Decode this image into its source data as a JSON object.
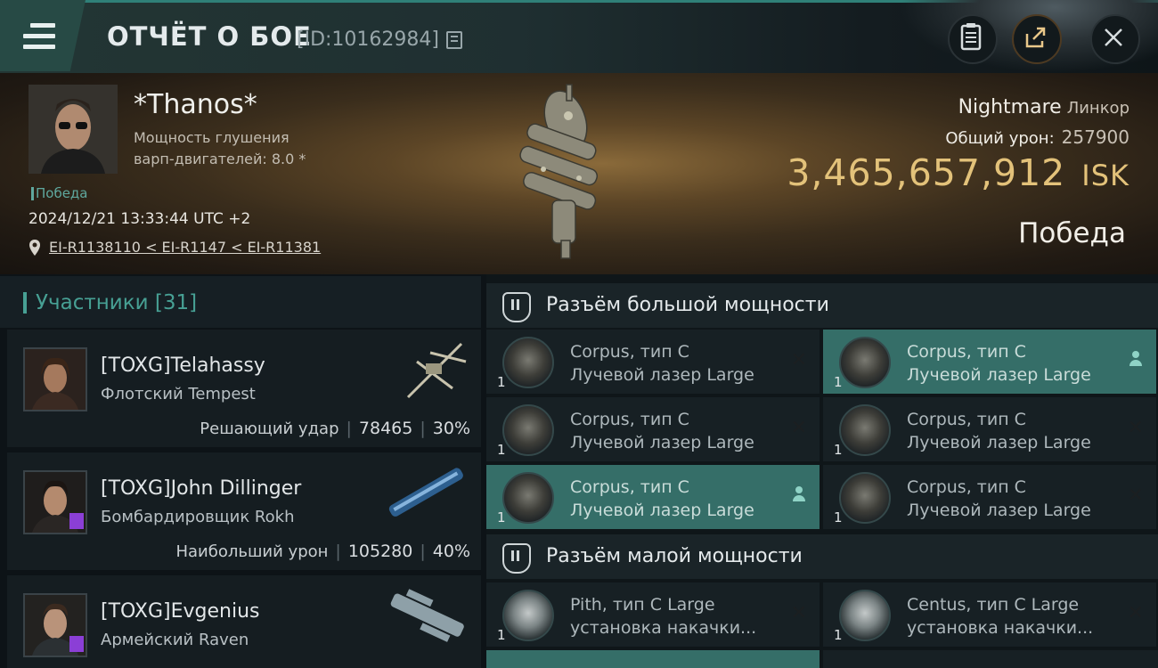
{
  "header": {
    "title": "ОТЧЁТ О БОЕ",
    "report_id": "[ID:10162984]",
    "icons": [
      "menu-icon",
      "copy-icon",
      "clipboard-icon",
      "share-icon",
      "close-icon"
    ]
  },
  "victim": {
    "name": "*Thanos*",
    "stat_line1": "Мощность глушения",
    "stat_line2": "варп-двигателей: 8.0 *",
    "result_small": "Победа",
    "datetime": "2024/12/21 13:33:44 UTC +2",
    "route": "EI-R1138110 < EI-R1147 < EI-R11381",
    "ship_name": "Nightmare",
    "ship_class": "Линкор",
    "damage_label": "Общий урон:",
    "damage_value": "257900",
    "isk_value": "3,465,657,912",
    "isk_unit": "ISK",
    "result_big": "Победа"
  },
  "participants": {
    "header": "Участники [31]",
    "items": [
      {
        "name": "[TOXG]Telahassy",
        "ship": "Флотский Tempest",
        "label": "Решающий удар",
        "damage": "78465",
        "percent": "30%"
      },
      {
        "name": "[TOXG]John Dillinger",
        "ship": "Бомбардировщик Rokh",
        "label": "Наибольший урон",
        "damage": "105280",
        "percent": "40%"
      },
      {
        "name": "[TOXG]Evgenius",
        "ship": "Армейский Raven",
        "label": "",
        "damage": "",
        "percent": ""
      }
    ]
  },
  "slots": {
    "high": {
      "title": "Разъём большой мощности",
      "modules": [
        {
          "qty": "1",
          "line1": "Corpus, тип C",
          "line2": "Лучевой лазер Large",
          "state": "destroyed"
        },
        {
          "qty": "1",
          "line1": "Corpus, тип C",
          "line2": "Лучевой лазер Large",
          "state": "dropped"
        },
        {
          "qty": "1",
          "line1": "Corpus, тип C",
          "line2": "Лучевой лазер Large",
          "state": "destroyed"
        },
        {
          "qty": "1",
          "line1": "Corpus, тип C",
          "line2": "Лучевой лазер Large",
          "state": "destroyed"
        },
        {
          "qty": "1",
          "line1": "Corpus, тип C",
          "line2": "Лучевой лазер Large",
          "state": "dropped"
        },
        {
          "qty": "1",
          "line1": "Corpus, тип C",
          "line2": "Лучевой лазер Large",
          "state": "destroyed"
        }
      ]
    },
    "low": {
      "title": "Разъём малой мощности",
      "modules": [
        {
          "qty": "1",
          "line1": "Pith, тип C Large",
          "line2": "установка накачки...",
          "state": "destroyed"
        },
        {
          "qty": "1",
          "line1": "Centus, тип C Large",
          "line2": "установка накачки...",
          "state": "destroyed"
        }
      ]
    }
  },
  "colors": {
    "accent": "#47a094",
    "isk": "#e3c27a",
    "highlight_row": "#356e68",
    "badge": "#8b3fd6"
  }
}
